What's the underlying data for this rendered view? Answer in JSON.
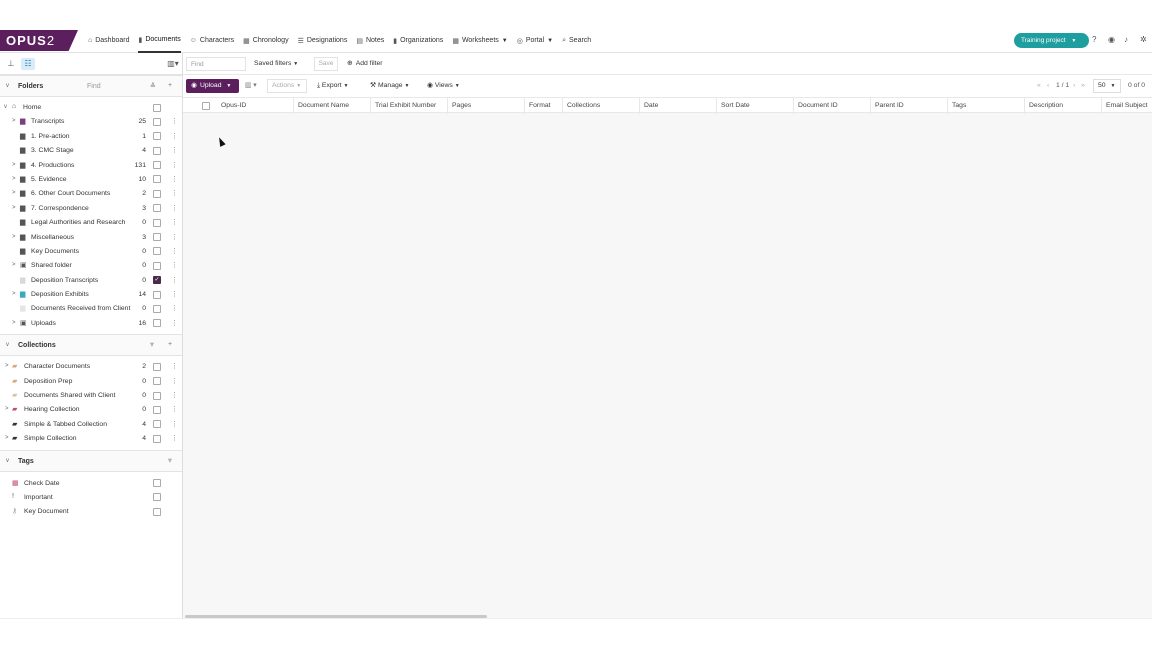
{
  "brand": {
    "logo_main": "OPUS",
    "logo_num": "2",
    "accent": "#5a1f5c",
    "teal": "#1e9e9e"
  },
  "nav": {
    "items": [
      {
        "label": "Dashboard",
        "icon": "home-icon",
        "glyph": "⌂"
      },
      {
        "label": "Documents",
        "icon": "document-icon",
        "glyph": "▮",
        "active": true
      },
      {
        "label": "Characters",
        "icon": "people-icon",
        "glyph": "☺"
      },
      {
        "label": "Chronology",
        "icon": "calendar-icon",
        "glyph": "▦"
      },
      {
        "label": "Designations",
        "icon": "list-icon",
        "glyph": "☰"
      },
      {
        "label": "Notes",
        "icon": "note-icon",
        "glyph": "▤"
      },
      {
        "label": "Organizations",
        "icon": "building-icon",
        "glyph": "▮"
      },
      {
        "label": "Worksheets",
        "icon": "grid-icon",
        "glyph": "▦",
        "caret": true
      },
      {
        "label": "Portal",
        "icon": "globe-icon",
        "glyph": "◎",
        "caret": true
      },
      {
        "label": "Search",
        "icon": "search-icon",
        "glyph": "⌕"
      }
    ],
    "project_label": "Training project"
  },
  "sidebar": {
    "folders_title": "Folders",
    "find_label": "Find",
    "folders": [
      {
        "label": "Home",
        "count": "",
        "expand": "v",
        "icon": "home-icon",
        "glyph": "⌂",
        "color": "#555",
        "indent": 0,
        "checked": false,
        "menu": false
      },
      {
        "label": "Transcripts",
        "count": "25",
        "expand": ">",
        "icon": "folder-icon",
        "glyph": "▆",
        "color": "#7b3f7e",
        "indent": 1,
        "checked": false,
        "menu": true
      },
      {
        "label": "1. Pre-action",
        "count": "1",
        "expand": "",
        "icon": "folder-icon",
        "glyph": "▆",
        "color": "#555",
        "indent": 1,
        "checked": false,
        "menu": true
      },
      {
        "label": "3. CMC Stage",
        "count": "4",
        "expand": "",
        "icon": "folder-icon",
        "glyph": "▆",
        "color": "#555",
        "indent": 1,
        "checked": false,
        "menu": true
      },
      {
        "label": "4. Productions",
        "count": "131",
        "expand": ">",
        "icon": "folder-icon",
        "glyph": "▆",
        "color": "#555",
        "indent": 1,
        "checked": false,
        "menu": true
      },
      {
        "label": "5. Evidence",
        "count": "10",
        "expand": ">",
        "icon": "folder-icon",
        "glyph": "▆",
        "color": "#555",
        "indent": 1,
        "checked": false,
        "menu": true
      },
      {
        "label": "6. Other Court Documents",
        "count": "2",
        "expand": ">",
        "icon": "folder-icon",
        "glyph": "▆",
        "color": "#555",
        "indent": 1,
        "checked": false,
        "menu": true
      },
      {
        "label": "7. Correspondence",
        "count": "3",
        "expand": ">",
        "icon": "folder-icon",
        "glyph": "▆",
        "color": "#555",
        "indent": 1,
        "checked": false,
        "menu": true
      },
      {
        "label": "Legal Authorities and Research",
        "count": "0",
        "expand": "",
        "icon": "folder-icon",
        "glyph": "▆",
        "color": "#555",
        "indent": 1,
        "checked": false,
        "menu": true
      },
      {
        "label": "Miscellaneous",
        "count": "3",
        "expand": ">",
        "icon": "folder-icon",
        "glyph": "▆",
        "color": "#555",
        "indent": 1,
        "checked": false,
        "menu": true
      },
      {
        "label": "Key Documents",
        "count": "0",
        "expand": "",
        "icon": "folder-icon",
        "glyph": "▆",
        "color": "#555",
        "indent": 1,
        "checked": false,
        "menu": true
      },
      {
        "label": "Shared folder",
        "count": "0",
        "expand": ">",
        "icon": "shared-folder-icon",
        "glyph": "▣",
        "color": "#555",
        "indent": 1,
        "checked": false,
        "menu": true
      },
      {
        "label": "Deposition Transcripts",
        "count": "0",
        "expand": "",
        "icon": "folder-icon",
        "glyph": "▆",
        "color": "#d9d9d9",
        "indent": 1,
        "checked": true,
        "menu": true
      },
      {
        "label": "Deposition Exhibits",
        "count": "14",
        "expand": ">",
        "icon": "folder-icon",
        "glyph": "▆",
        "color": "#3aaac0",
        "indent": 1,
        "checked": false,
        "menu": true
      },
      {
        "label": "Documents Received from Client",
        "count": "0",
        "expand": "",
        "icon": "folder-icon",
        "glyph": "▆",
        "color": "#e5e5e5",
        "indent": 1,
        "checked": false,
        "menu": true
      },
      {
        "label": "Uploads",
        "count": "16",
        "expand": ">",
        "icon": "upload-folder-icon",
        "glyph": "▣",
        "color": "#555",
        "indent": 1,
        "checked": false,
        "menu": true
      }
    ],
    "collections_title": "Collections",
    "collections": [
      {
        "label": "Character Documents",
        "count": "2",
        "expand": ">",
        "icon": "collection-icon",
        "glyph": "▰",
        "color": "#d8a878",
        "checked": false
      },
      {
        "label": "Deposition Prep",
        "count": "0",
        "expand": "",
        "icon": "collection-icon",
        "glyph": "▰",
        "color": "#d8a878",
        "checked": false
      },
      {
        "label": "Documents Shared with Client",
        "count": "0",
        "expand": "",
        "icon": "collection-icon",
        "glyph": "▰",
        "color": "#d8c0a0",
        "checked": false
      },
      {
        "label": "Hearing Collection",
        "count": "0",
        "expand": ">",
        "icon": "collection-icon",
        "glyph": "▰",
        "color": "#c0506a",
        "checked": false
      },
      {
        "label": "Simple & Tabbed Collection",
        "count": "4",
        "expand": "",
        "icon": "collection-icon",
        "glyph": "▰",
        "color": "#333",
        "checked": false
      },
      {
        "label": "Simple Collection",
        "count": "4",
        "expand": ">",
        "icon": "collection-icon",
        "glyph": "▰",
        "color": "#333",
        "checked": false
      }
    ],
    "tags_title": "Tags",
    "tags": [
      {
        "label": "Check Date",
        "icon": "calendar-tag-icon",
        "glyph": "▦",
        "color": "#c0506a"
      },
      {
        "label": "Important",
        "icon": "exclamation-icon",
        "glyph": "!",
        "color": "#555"
      },
      {
        "label": "Key Document",
        "icon": "key-icon",
        "glyph": "⚷",
        "color": "#999"
      }
    ]
  },
  "toolbar": {
    "find_placeholder": "Find",
    "saved_filters": "Saved filters",
    "save": "Save",
    "add_filter": "Add filter",
    "upload": "Upload",
    "actions": "Actions",
    "export": "Export",
    "manage": "Manage",
    "views": "Views",
    "page_indicator": "1 / 1",
    "per_page": "50",
    "result_count": "0 of 0"
  },
  "table": {
    "columns": [
      {
        "label": "Opus-ID",
        "w": 77
      },
      {
        "label": "Document Name",
        "w": 77
      },
      {
        "label": "Trial Exhibit Number",
        "w": 77
      },
      {
        "label": "Pages",
        "w": 77
      },
      {
        "label": "Format",
        "w": 38
      },
      {
        "label": "Collections",
        "w": 77
      },
      {
        "label": "Date",
        "w": 77
      },
      {
        "label": "Sort Date",
        "w": 77
      },
      {
        "label": "Document ID",
        "w": 77
      },
      {
        "label": "Parent ID",
        "w": 77
      },
      {
        "label": "Tags",
        "w": 77
      },
      {
        "label": "Description",
        "w": 77
      },
      {
        "label": "Email Subject",
        "w": 60
      }
    ]
  }
}
